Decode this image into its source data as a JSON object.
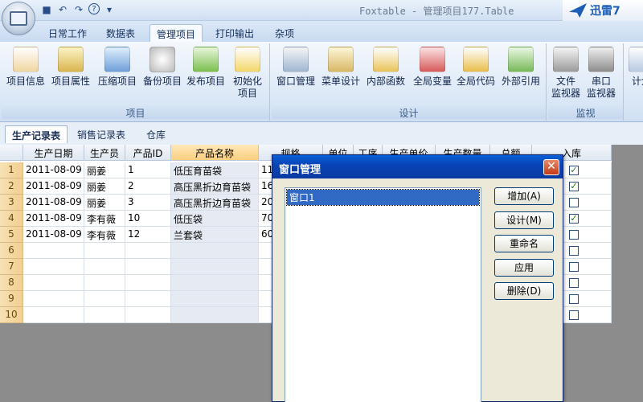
{
  "app_title": "Foxtable - 管理项目177.Table",
  "brand": {
    "name": "迅雷7"
  },
  "quick_access": [
    {
      "name": "save-icon",
      "glyph": "■"
    },
    {
      "name": "undo-icon",
      "glyph": "↶"
    },
    {
      "name": "redo-icon",
      "glyph": "↷"
    },
    {
      "name": "help-icon",
      "glyph": "?"
    },
    {
      "name": "customize-icon",
      "glyph": "▾"
    }
  ],
  "menu_tabs": [
    "日常工作",
    "数据表",
    "管理项目",
    "打印输出",
    "杂项"
  ],
  "active_menu": "管理项目",
  "ribbon": {
    "groups": [
      {
        "label": "项目",
        "buttons": [
          "项目信息",
          "项目属性",
          "压缩项目",
          "备份项目",
          "发布项目",
          "初始化项目"
        ]
      },
      {
        "label": "设计",
        "buttons": [
          "窗口管理",
          "菜单设计",
          "内部函数",
          "全局变量",
          "全局代码",
          "外部引用"
        ]
      },
      {
        "label": "监视",
        "buttons": [
          "文件监视器",
          "串口监视器"
        ]
      },
      {
        "label": "",
        "buttons": [
          "计划"
        ]
      }
    ],
    "initialize_line1": "初始化",
    "initialize_line2": "项目",
    "file_monitor_line1": "文件",
    "file_monitor_line2": "监视器",
    "serial_monitor_line1": "串口",
    "serial_monitor_line2": "监视器",
    "plan_label": "计划"
  },
  "sheet_tabs": [
    "生产记录表",
    "销售记录表",
    "仓库"
  ],
  "active_sheet": "生产记录表",
  "table": {
    "columns": [
      "生产日期",
      "生产员",
      "产品ID",
      "产品名称",
      "规格",
      "单位",
      "工序",
      "生产单价",
      "生产数量",
      "总额",
      "入库"
    ],
    "rows": [
      {
        "num": "1",
        "date": "2011-08-09",
        "worker": "丽姜",
        "pid": "1",
        "name": "低压育苗袋",
        "spec": "11",
        "stored": true
      },
      {
        "num": "2",
        "date": "2011-08-09",
        "worker": "丽姜",
        "pid": "2",
        "name": "高压黑折边育苗袋",
        "spec": "16",
        "stored": true
      },
      {
        "num": "3",
        "date": "2011-08-09",
        "worker": "丽姜",
        "pid": "3",
        "name": "高压黑折边育苗袋",
        "spec": "20",
        "stored": false
      },
      {
        "num": "4",
        "date": "2011-08-09",
        "worker": "李有薇",
        "pid": "10",
        "name": "低压袋",
        "spec": "70",
        "stored": true
      },
      {
        "num": "5",
        "date": "2011-08-09",
        "worker": "李有薇",
        "pid": "12",
        "name": "兰套袋",
        "spec": "60",
        "stored": false
      },
      {
        "num": "6",
        "date": "",
        "worker": "",
        "pid": "",
        "name": "",
        "spec": "",
        "stored": false
      },
      {
        "num": "7",
        "date": "",
        "worker": "",
        "pid": "",
        "name": "",
        "spec": "",
        "stored": false
      },
      {
        "num": "8",
        "date": "",
        "worker": "",
        "pid": "",
        "name": "",
        "spec": "",
        "stored": false
      },
      {
        "num": "9",
        "date": "",
        "worker": "",
        "pid": "",
        "name": "",
        "spec": "",
        "stored": false
      },
      {
        "num": "10",
        "date": "",
        "worker": "",
        "pid": "",
        "name": "",
        "spec": "",
        "stored": false
      }
    ]
  },
  "dialog": {
    "title": "窗口管理",
    "list_items": [
      "窗口1"
    ],
    "buttons": [
      {
        "label": "增加",
        "hotkey": "A"
      },
      {
        "label": "设计",
        "hotkey": "M"
      },
      {
        "label": "重命名",
        "hotkey": ""
      },
      {
        "label": "应用",
        "hotkey": ""
      },
      {
        "label": "删除",
        "hotkey": "D"
      }
    ],
    "btn_add": "增加(A)",
    "btn_design": "设计(M)",
    "btn_rename": "重命名",
    "btn_apply": "应用",
    "btn_delete": "删除(D)"
  },
  "colors": {
    "accent": "#0a5fd6",
    "ribbon": "#dce8f6",
    "selected_header": "#fbcf7f"
  }
}
